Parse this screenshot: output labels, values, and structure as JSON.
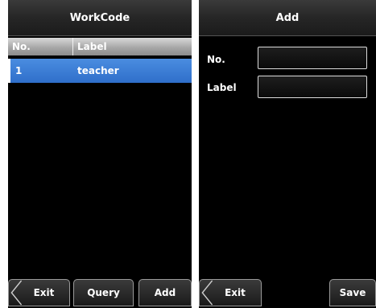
{
  "left_screen": {
    "title": "WorkCode",
    "table": {
      "headers": [
        "No.",
        "Label"
      ],
      "rows": [
        {
          "no": "1",
          "label": "teacher"
        }
      ]
    },
    "buttons": {
      "exit": "Exit",
      "query": "Query",
      "add": "Add"
    }
  },
  "right_screen": {
    "title": "Add",
    "fields": {
      "no_label": "No.",
      "no_value": "",
      "label_label": "Label",
      "label_value": ""
    },
    "buttons": {
      "exit": "Exit",
      "save": "Save"
    }
  },
  "colors": {
    "selection": "#3a7bd5",
    "background": "#000000",
    "text": "#ffffff"
  }
}
